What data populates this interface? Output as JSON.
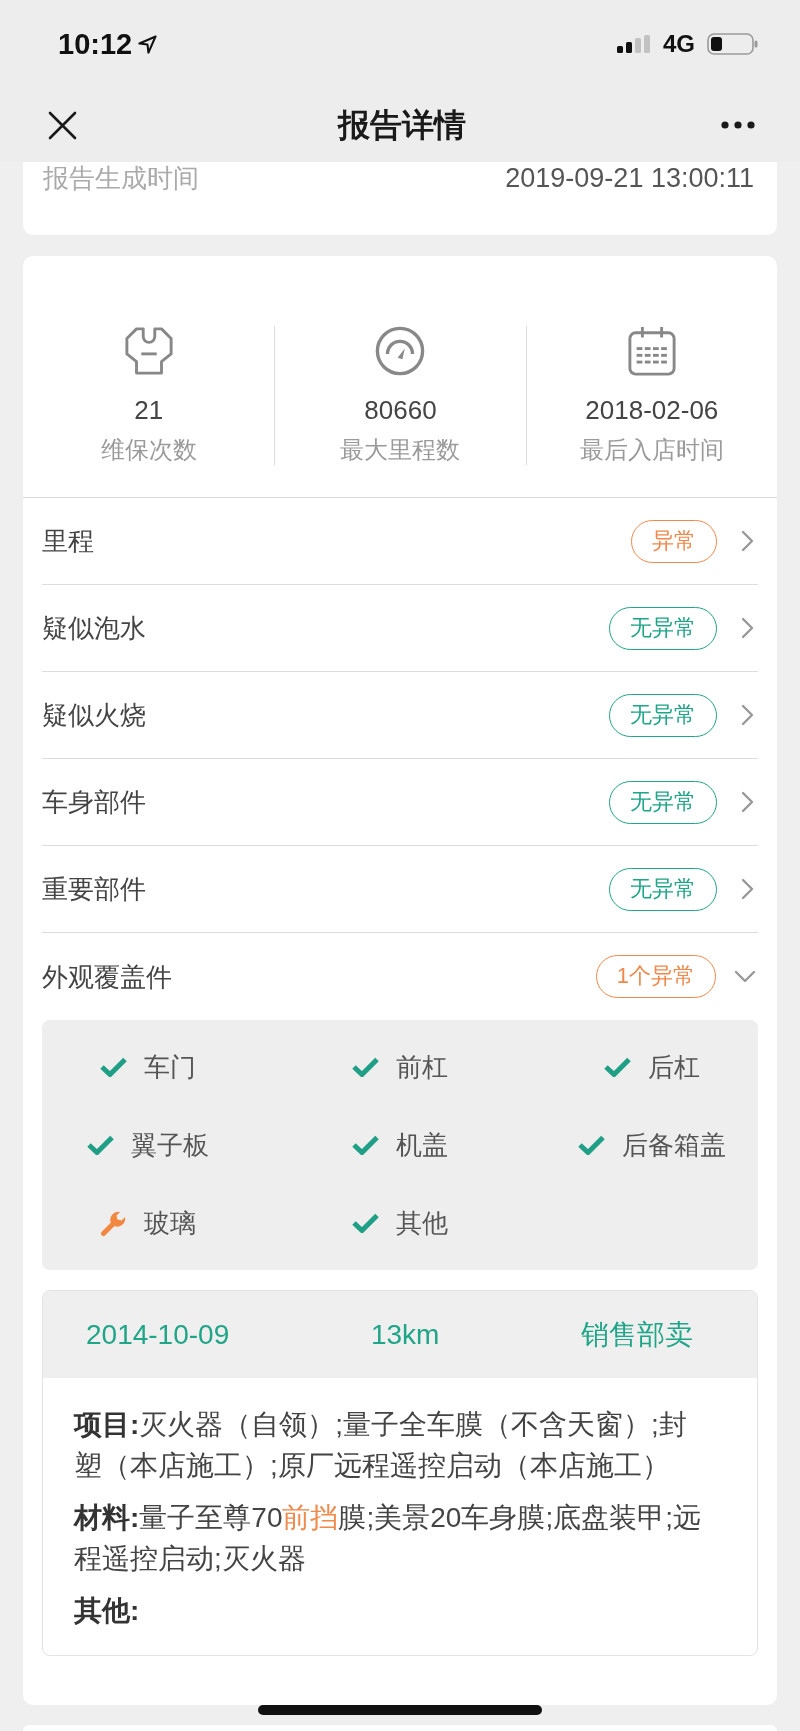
{
  "status_bar": {
    "time": "10:12",
    "network": "4G"
  },
  "nav_bar": {
    "title": "报告详情"
  },
  "report_info": {
    "label": "报告生成时间",
    "value": "2019-09-21 13:00:11"
  },
  "stats": [
    {
      "kind": "maintenance",
      "value": "21",
      "label": "维保次数"
    },
    {
      "kind": "mileage",
      "value": "80660",
      "label": "最大里程数"
    },
    {
      "kind": "calendar",
      "value": "2018-02-06",
      "label": "最后入店时间"
    }
  ],
  "checks": [
    {
      "label": "里程",
      "status": "异常",
      "abnormal": true,
      "expanded": false
    },
    {
      "label": "疑似泡水",
      "status": "无异常",
      "abnormal": false,
      "expanded": false
    },
    {
      "label": "疑似火烧",
      "status": "无异常",
      "abnormal": false,
      "expanded": false
    },
    {
      "label": "车身部件",
      "status": "无异常",
      "abnormal": false,
      "expanded": false
    },
    {
      "label": "重要部件",
      "status": "无异常",
      "abnormal": false,
      "expanded": false
    },
    {
      "label": "外观覆盖件",
      "status": "1个异常",
      "abnormal": true,
      "expanded": true,
      "parts": [
        {
          "label": "车门",
          "abnormal": false
        },
        {
          "label": "前杠",
          "abnormal": false
        },
        {
          "label": "后杠",
          "abnormal": false
        },
        {
          "label": "翼子板",
          "abnormal": false
        },
        {
          "label": "机盖",
          "abnormal": false
        },
        {
          "label": "后备箱盖",
          "abnormal": false
        },
        {
          "label": "玻璃",
          "abnormal": true
        },
        {
          "label": "其他",
          "abnormal": false
        }
      ]
    }
  ],
  "record": {
    "date": "2014-10-09",
    "mileage": "13km",
    "type": "销售部卖",
    "details": [
      {
        "label": "项目:",
        "segments": [
          {
            "text": "灭火器（自领）;量子全车膜（不含天窗）;封塑（本店施工）;原厂远程遥控启动（本店施工）",
            "highlight": false
          }
        ]
      },
      {
        "label": "材料:",
        "segments": [
          {
            "text": "量子至尊70",
            "highlight": false
          },
          {
            "text": "前挡",
            "highlight": true
          },
          {
            "text": "膜;美景20车身膜;底盘装甲;远程遥控启动;灭火器",
            "highlight": false
          }
        ]
      },
      {
        "label": "其他:"
      }
    ]
  }
}
